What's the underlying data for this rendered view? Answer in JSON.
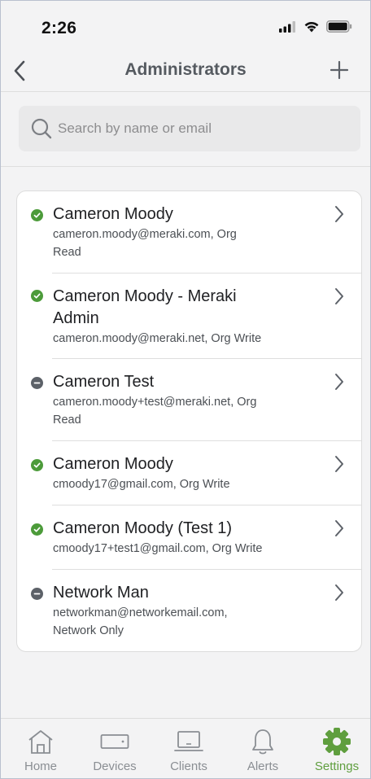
{
  "status_bar": {
    "time": "2:26",
    "icons": [
      "cellular-signal-icon",
      "wifi-icon",
      "battery-icon"
    ]
  },
  "header": {
    "title": "Administrators",
    "back_icon": "chevron-left-icon",
    "add_icon": "plus-icon"
  },
  "search": {
    "placeholder": "Search by name or email",
    "value": ""
  },
  "colors": {
    "active_status": "#4c9b3a",
    "inactive_status": "#5c6168",
    "accent": "#5f9e3e"
  },
  "administrators": [
    {
      "name": "Cameron Moody",
      "detail_line1": "cameron.moody@meraki.com, Org",
      "detail_line2": "Read",
      "status": "active"
    },
    {
      "name_line1": "Cameron Moody - Meraki",
      "name_line2": "Admin",
      "detail_line1": "cameron.moody@meraki.net, Org Write",
      "status": "active"
    },
    {
      "name": "Cameron Test",
      "detail_line1": "cameron.moody+test@meraki.net, Org",
      "detail_line2": "Read",
      "status": "inactive"
    },
    {
      "name": "Cameron Moody",
      "detail_line1": "cmoody17@gmail.com, Org Write",
      "status": "active"
    },
    {
      "name": "Cameron Moody (Test 1)",
      "detail_line1": "cmoody17+test1@gmail.com, Org Write",
      "status": "active"
    },
    {
      "name": "Network Man",
      "detail_line1": "networkman@networkemail.com,",
      "detail_line2": "Network Only",
      "status": "inactive"
    }
  ],
  "tab_bar": {
    "tabs": [
      {
        "label": "Home",
        "icon": "home-icon",
        "active": false
      },
      {
        "label": "Devices",
        "icon": "device-icon",
        "active": false
      },
      {
        "label": "Clients",
        "icon": "laptop-icon",
        "active": false
      },
      {
        "label": "Alerts",
        "icon": "bell-icon",
        "active": false
      },
      {
        "label": "Settings",
        "icon": "gear-icon",
        "active": true
      }
    ]
  }
}
